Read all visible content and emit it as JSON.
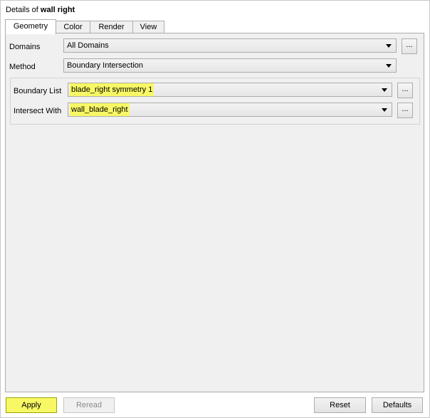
{
  "header": {
    "prefix": "Details of",
    "object": "wall right"
  },
  "tabs": [
    {
      "label": "Geometry"
    },
    {
      "label": "Color"
    },
    {
      "label": "Render"
    },
    {
      "label": "View"
    }
  ],
  "domains": {
    "label": "Domains",
    "value": "All Domains",
    "more": "..."
  },
  "method": {
    "label": "Method",
    "value": "Boundary Intersection"
  },
  "boundary_list": {
    "label": "Boundary List",
    "value": "blade_right symmetry 1",
    "more": "..."
  },
  "intersect_with": {
    "label": "Intersect With",
    "value": "wall_blade_right",
    "more": "..."
  },
  "buttons": {
    "apply": "Apply",
    "reread": "Reread",
    "reset": "Reset",
    "defaults": "Defaults"
  },
  "colors": {
    "highlight": "#f8f866",
    "panel_bg": "#f0f0f0"
  }
}
